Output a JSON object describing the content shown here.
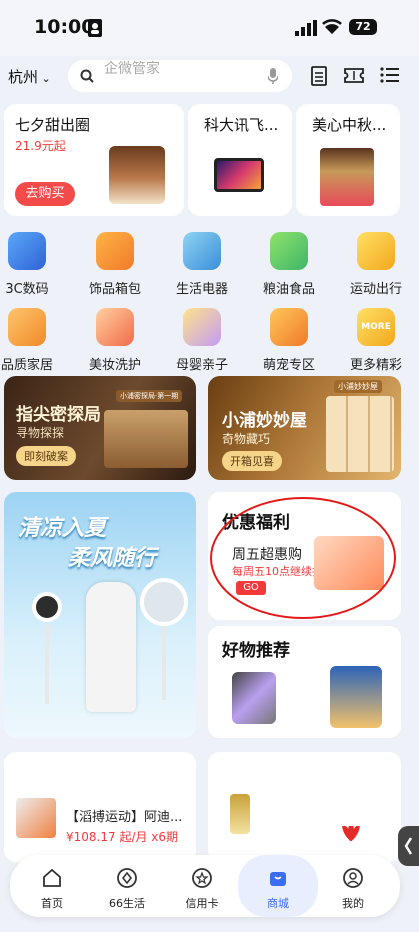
{
  "status": {
    "time": "10:00",
    "battery": "72"
  },
  "header": {
    "city": "杭州",
    "search_placeholder": "企微管家"
  },
  "featured": [
    {
      "title": "七夕甜出圈",
      "price": "21.9元起",
      "button": "去购买"
    },
    {
      "title": "科大讯飞..."
    },
    {
      "title": "美心中秋..."
    }
  ],
  "categories": [
    {
      "label": "3C数码"
    },
    {
      "label": "饰品箱包"
    },
    {
      "label": "生活电器"
    },
    {
      "label": "粮油食品"
    },
    {
      "label": "运动出行"
    },
    {
      "label": "品质家居"
    },
    {
      "label": "美妆洗护"
    },
    {
      "label": "母婴亲子"
    },
    {
      "label": "萌宠专区"
    },
    {
      "label": "更多精彩"
    }
  ],
  "banners": {
    "left": {
      "title": "指尖密探局",
      "subtitle": "寻物探探",
      "button": "即刻破案",
      "tag": "小浦密探局·第一期"
    },
    "right": {
      "title": "小浦妙妙屋",
      "subtitle": "奇物藏巧",
      "button": "开箱见喜",
      "tag": "小浦妙妙屋"
    }
  },
  "summer": {
    "line1": "清凉入夏",
    "line2": "柔风随行"
  },
  "welfare": {
    "title": "优惠福利",
    "sub": "周五超惠购",
    "detail": "每周五10点继续抢",
    "button": "GO"
  },
  "goods": {
    "title": "好物推荐"
  },
  "product": {
    "name": "【滔搏运动】阿迪...",
    "price": "¥108.17 起/月 x6期"
  },
  "nav": [
    {
      "label": "首页"
    },
    {
      "label": "66生活"
    },
    {
      "label": "信用卡"
    },
    {
      "label": "商城"
    },
    {
      "label": "我的"
    }
  ],
  "colors": {
    "accent": "#3a6df0",
    "red": "#f23a3a",
    "bg": "#eef1f8"
  }
}
